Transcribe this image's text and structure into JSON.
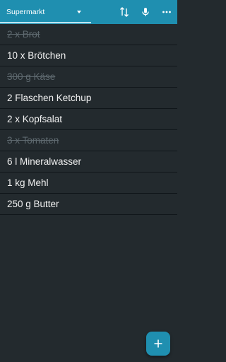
{
  "header": {
    "list_selector": {
      "value": "Supermarkt"
    },
    "actions": [
      {
        "name": "sort-icon"
      },
      {
        "name": "microphone-icon"
      },
      {
        "name": "more-options-icon"
      }
    ]
  },
  "items": [
    {
      "text": "2 x Brot",
      "checked": true
    },
    {
      "text": "10 x Brötchen",
      "checked": false
    },
    {
      "text": "300 g Käse",
      "checked": true
    },
    {
      "text": "2 Flaschen Ketchup",
      "checked": false
    },
    {
      "text": "2 x Kopfsalat",
      "checked": false
    },
    {
      "text": "3 x Tomaten",
      "checked": true
    },
    {
      "text": "6 l Mineralwasser",
      "checked": false
    },
    {
      "text": "1 kg Mehl",
      "checked": false
    },
    {
      "text": "250 g Butter",
      "checked": false
    }
  ],
  "fab": {
    "icon": "plus-icon"
  },
  "colors": {
    "accent": "#1f8fb0",
    "background": "#232a2e",
    "text": "#f2f2f2",
    "checked_text": "#5f6a70"
  }
}
